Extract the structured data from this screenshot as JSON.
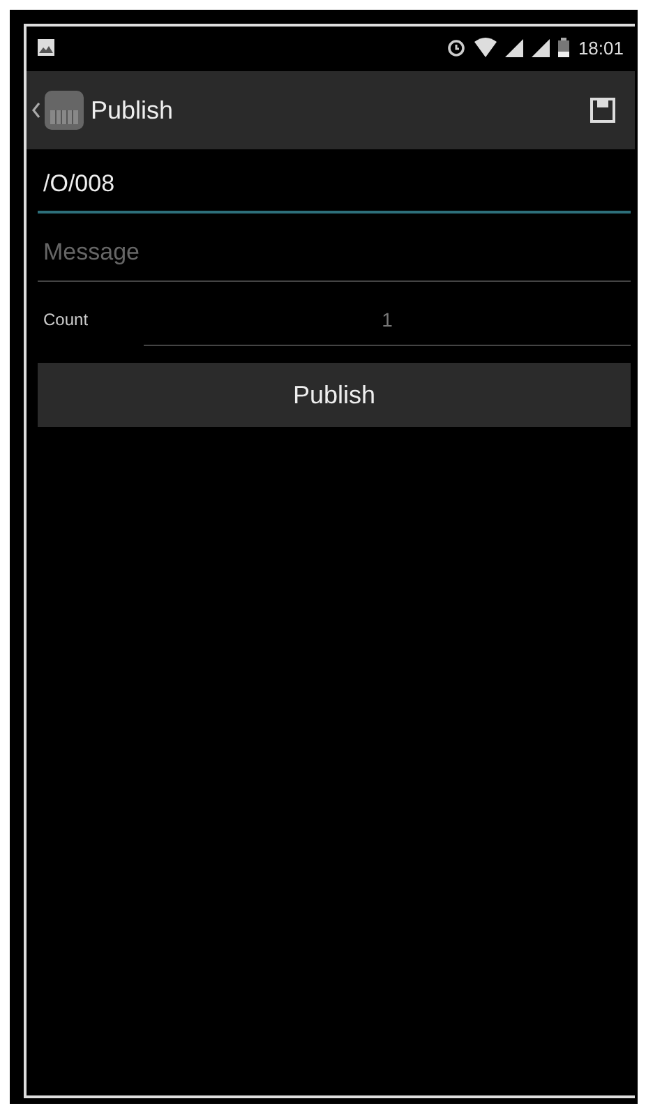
{
  "status_bar": {
    "time": "18:01"
  },
  "action_bar": {
    "title": "Publish"
  },
  "topic_field": {
    "value": "/O/008",
    "focused": true
  },
  "message_field": {
    "placeholder": "Message"
  },
  "count": {
    "label": "Count",
    "value": "1"
  },
  "publish_button": {
    "label": "Publish"
  }
}
